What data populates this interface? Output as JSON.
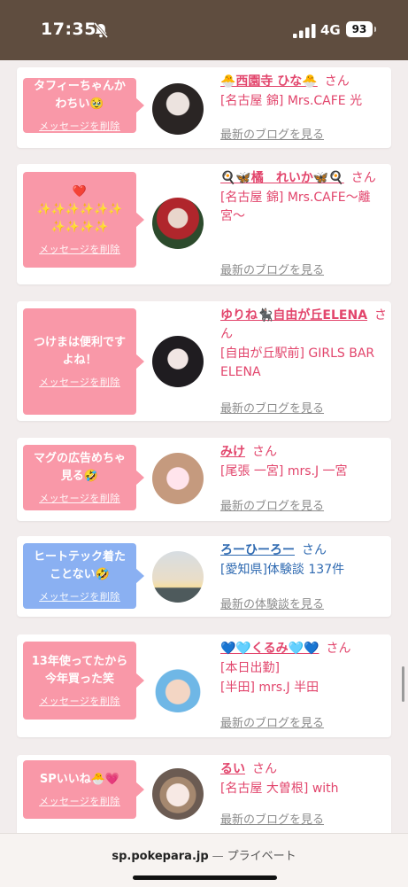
{
  "status_bar": {
    "time": "17:35",
    "network": "4G",
    "battery": "93",
    "bell_icon": "bell-slash-icon",
    "signal_icon": "cellular-signal-icon"
  },
  "colors": {
    "status_bar_bg": "#5f4d3f",
    "bubble_pink": "#f998a8",
    "bubble_blue": "#8ab0f2",
    "name_pink": "#e2456c",
    "name_blue": "#2f6ab1",
    "link_gray": "#8c8c8c"
  },
  "cards": [
    {
      "message": "タフィーちゃんか\nわちい🥹",
      "delete_label": "メッセージを削除",
      "name": "🐣西園寺 ひな🐣",
      "suffix": "さん",
      "details": [
        "[名古屋 錦] Mrs.CAFE 光"
      ],
      "link": "最新のブログを見る"
    },
    {
      "message": "❤️\n✨✨✨✨✨✨\n✨✨✨✨",
      "delete_label": "メッセージを削除",
      "name": "🍳🦋橘　れいか🦋🍳",
      "suffix": "さん",
      "details": [
        "[名古屋 錦] Mrs.CAFE〜離宮〜"
      ],
      "link": "最新のブログを見る"
    },
    {
      "message": "つけまは便利です\nよね！",
      "delete_label": "メッセージを削除",
      "name": "ゆりね🐈‍⬛自由が丘ELENA",
      "suffix": "さん",
      "details": [
        "[自由が丘駅前] GIRLS BAR ELENA"
      ],
      "link": "最新のブログを見る"
    },
    {
      "message": "マグの広告めちゃ\n見る🤣",
      "delete_label": "メッセージを削除",
      "name": "みけ",
      "suffix": "さん",
      "details": [
        "[尾張 一宮] mrs.J 一宮"
      ],
      "link": "最新のブログを見る"
    },
    {
      "message": "ヒートテック着た\nことない🤣",
      "delete_label": "メッセージを削除",
      "name": "ろーひーろー",
      "suffix": "さん",
      "details": [
        "[愛知県]体験談 137件"
      ],
      "link": "最新の体験談を見る"
    },
    {
      "message": "13年使ってたから\n今年買った笑",
      "delete_label": "メッセージを削除",
      "name": "💙🩵くるみ🩵💙",
      "suffix": "さん",
      "details": [
        "[本日出勤]",
        "[半田] mrs.J 半田"
      ],
      "link": "最新のブログを見る"
    },
    {
      "message": "SPいいね🐣💗",
      "delete_label": "メッセージを削除",
      "name": "るい",
      "suffix": "さん",
      "details": [
        "[名古屋 大曽根] with"
      ],
      "link": "最新のブログを見る"
    }
  ],
  "browser": {
    "host": "sp.pokepara.jp",
    "separator": "—",
    "mode": "プライベート"
  }
}
